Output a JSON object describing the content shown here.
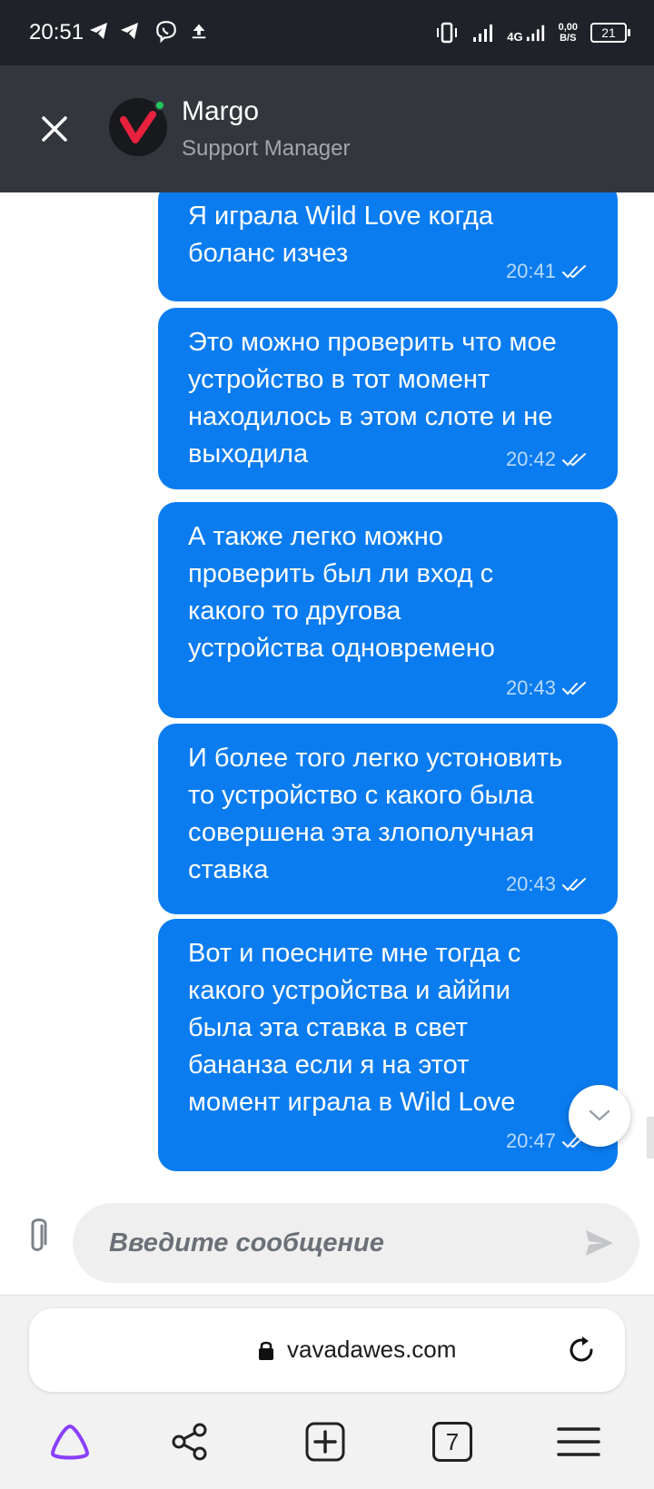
{
  "status_bar": {
    "time": "20:51",
    "network": "4G",
    "speed_value": "0,00",
    "speed_unit": "B/S",
    "battery": "21"
  },
  "header": {
    "agent_name": "Margo",
    "agent_role": "Support Manager"
  },
  "messages": [
    {
      "text": "Я играла Wild Love когда боланс изчез",
      "time": "20:41"
    },
    {
      "text": "Это можно проверить что мое устройство в тот момент находилось в этом слоте и не выходила",
      "time": "20:42"
    },
    {
      "text": "А также легко можно проверить был ли вход с какого то другова устройства одновремено",
      "time": "20:43"
    },
    {
      "text": "И более того легко устоновить то устройство с какого была совершена эта злополучная ставка",
      "time": "20:43"
    },
    {
      "text": "Вот и поесните мне тогда с какого устройства и аййпи была эта ставка в свет бананза если я на этот момент играла в Wild Love",
      "time": "20:47"
    }
  ],
  "composer": {
    "placeholder": "Введите сообщение"
  },
  "browser": {
    "url": "vavadawes.com",
    "tab_count": "7"
  },
  "colors": {
    "bubble": "#0a7cf0",
    "header": "#33373d",
    "status_bar": "#1f2228",
    "accent_red": "#e8213f",
    "alice_purple": "#8a3ffc"
  }
}
